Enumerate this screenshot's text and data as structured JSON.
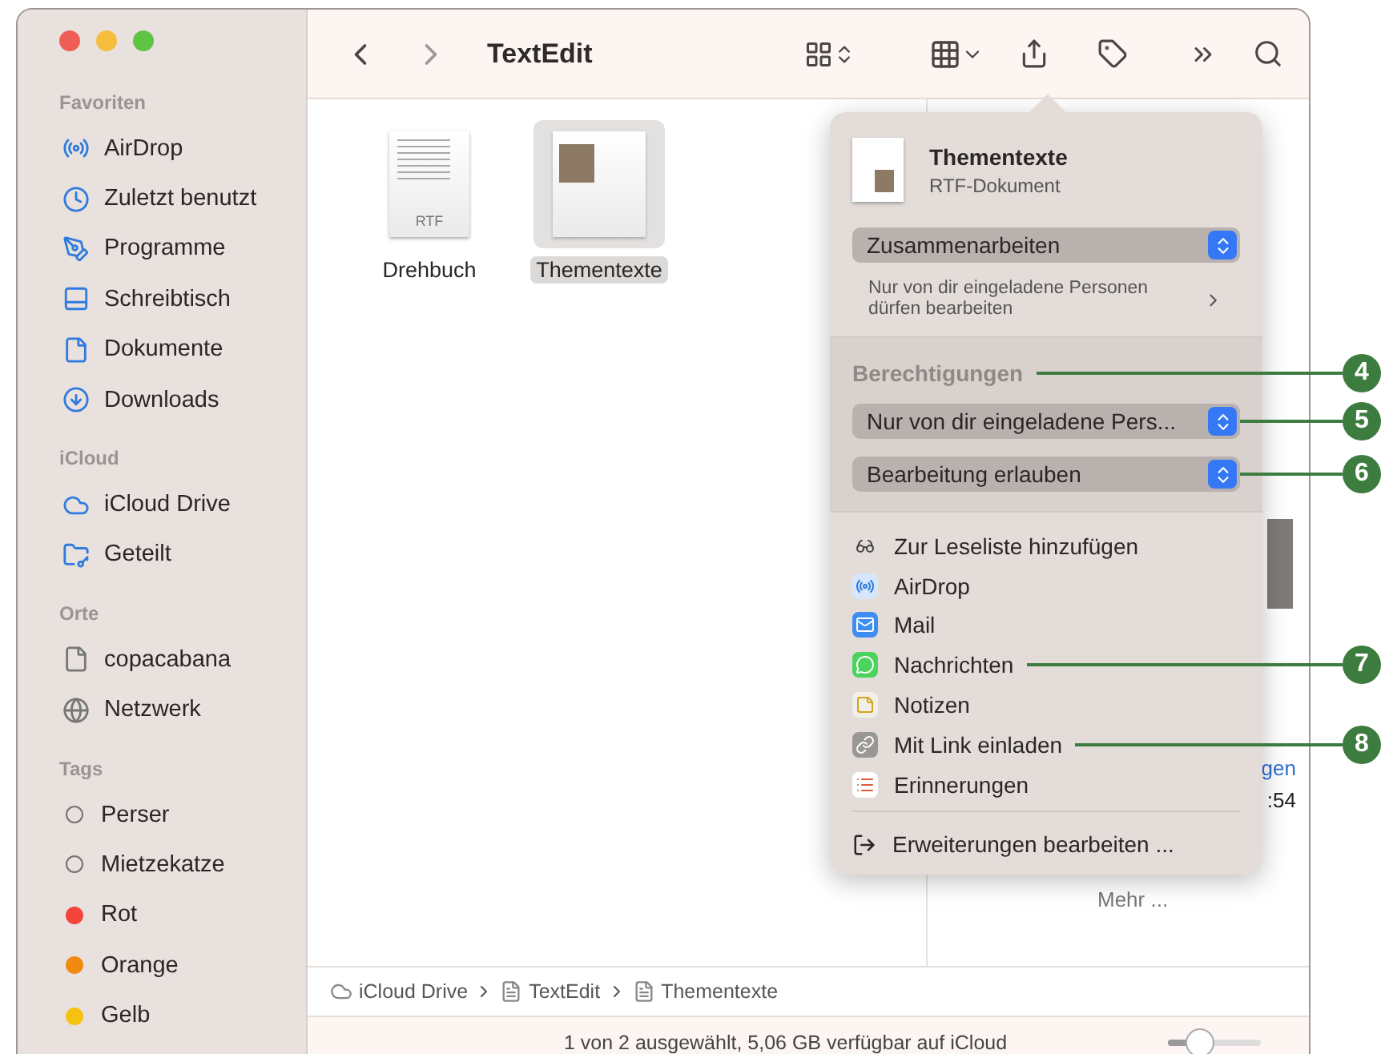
{
  "window": {
    "title": "TextEdit"
  },
  "sidebar": [
    {
      "heading": "Favoriten",
      "items": [
        {
          "label": "AirDrop"
        },
        {
          "label": "Zuletzt benutzt"
        },
        {
          "label": "Programme"
        },
        {
          "label": "Schreibtisch"
        },
        {
          "label": "Dokumente"
        },
        {
          "label": "Downloads"
        }
      ]
    },
    {
      "heading": "iCloud",
      "items": [
        {
          "label": "iCloud Drive"
        },
        {
          "label": "Geteilt"
        }
      ]
    },
    {
      "heading": "Orte",
      "items": [
        {
          "label": "copacabana"
        },
        {
          "label": "Netzwerk"
        }
      ]
    },
    {
      "heading": "Tags",
      "tags": [
        {
          "label": "Perser"
        },
        {
          "label": "Mietzekatze"
        },
        {
          "label": "Rot",
          "color": "#f2443b"
        },
        {
          "label": "Orange",
          "color": "#f08a12"
        },
        {
          "label": "Gelb",
          "color": "#f5c211"
        }
      ]
    }
  ],
  "files": [
    {
      "name": "Drehbuch",
      "kind": "rtf",
      "badge": "RTF",
      "selected": false
    },
    {
      "name": "Thementexte",
      "kind": "photo-doc",
      "selected": true
    }
  ],
  "preview": {
    "fragments": [
      "gen",
      ":54"
    ],
    "more_label": "Mehr ..."
  },
  "share_popover": {
    "title": "Thementexte",
    "subtitle": "RTF-Dokument",
    "mode": "Zusammenarbeiten",
    "access_note": "Nur von dir eingeladene Personen dürfen bearbeiten",
    "permissions": {
      "heading": "Berechtigungen",
      "callout": "4",
      "selects": [
        {
          "value": "Nur von dir eingeladene Pers...",
          "callout": "5"
        },
        {
          "value": "Bearbeitung erlauben",
          "callout": "6"
        }
      ]
    },
    "targets": [
      {
        "label": "Zur Leseliste hinzufügen",
        "kind": "reading-list"
      },
      {
        "label": "AirDrop",
        "kind": "airdrop"
      },
      {
        "label": "Mail",
        "kind": "mail"
      },
      {
        "label": "Nachrichten",
        "kind": "messages",
        "callout": "7"
      },
      {
        "label": "Notizen",
        "kind": "notes"
      },
      {
        "label": "Mit Link einladen",
        "kind": "link",
        "callout": "8"
      },
      {
        "label": "Erinnerungen",
        "kind": "reminders"
      }
    ],
    "footer": "Erweiterungen bearbeiten ..."
  },
  "path_bar": [
    "iCloud Drive",
    "TextEdit",
    "Thementexte"
  ],
  "status_bar": {
    "text": "1 von 2 ausgewählt, 5,06 GB verfügbar auf iCloud",
    "zoom": {
      "level": 0.35
    }
  }
}
